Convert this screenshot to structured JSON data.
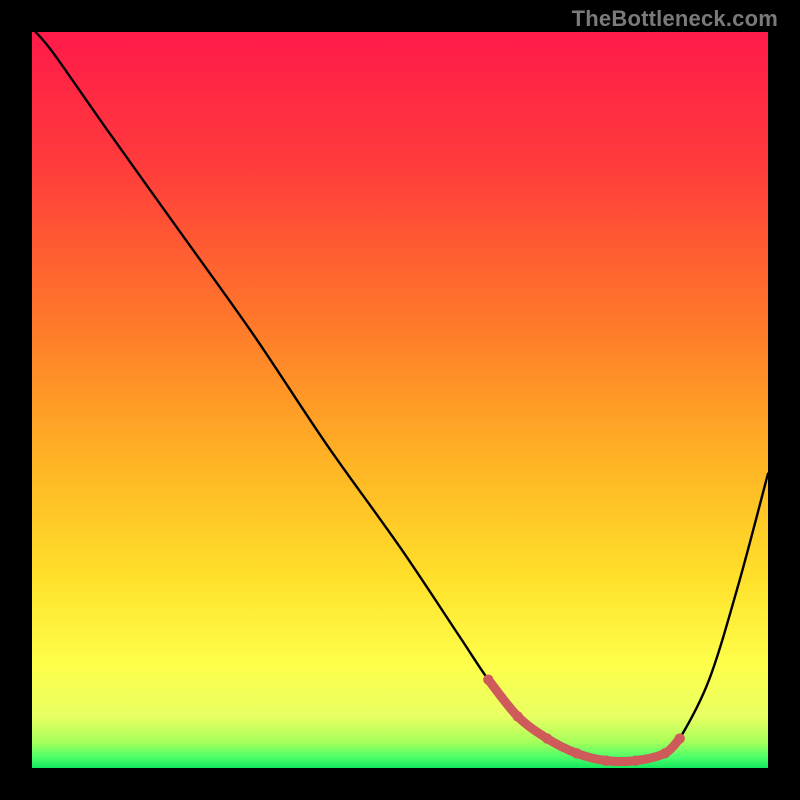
{
  "watermark": "TheBottleneck.com",
  "chart_data": {
    "type": "line",
    "title": "",
    "xlabel": "",
    "ylabel": "",
    "xlim": [
      0,
      100
    ],
    "ylim": [
      0,
      100
    ],
    "grid": false,
    "legend": false,
    "series": [
      {
        "name": "bottleneck-curve",
        "color": "#000000",
        "x": [
          0.5,
          3,
          10,
          20,
          30,
          40,
          50,
          58,
          62,
          66,
          70,
          74,
          78,
          82,
          86,
          88,
          92,
          96,
          100
        ],
        "y": [
          100,
          97,
          87,
          73,
          59,
          44,
          30,
          18,
          12,
          7,
          4,
          2,
          1,
          1,
          2,
          4,
          12,
          25,
          40
        ]
      },
      {
        "name": "bottleneck-threshold-marker",
        "color": "#cf5a5a",
        "x": [
          62,
          66,
          70,
          74,
          78,
          82,
          86,
          88
        ],
        "y": [
          12,
          7,
          4,
          2,
          1,
          1,
          2,
          4
        ]
      }
    ],
    "background_gradient": {
      "stops": [
        {
          "offset": 0.0,
          "color": "#ff1a4a"
        },
        {
          "offset": 0.18,
          "color": "#ff3b3b"
        },
        {
          "offset": 0.4,
          "color": "#ff7a2a"
        },
        {
          "offset": 0.58,
          "color": "#ffb224"
        },
        {
          "offset": 0.74,
          "color": "#ffe02a"
        },
        {
          "offset": 0.86,
          "color": "#feff4a"
        },
        {
          "offset": 0.93,
          "color": "#e8ff63"
        },
        {
          "offset": 0.965,
          "color": "#a6ff5a"
        },
        {
          "offset": 0.985,
          "color": "#4dff6a"
        },
        {
          "offset": 1.0,
          "color": "#15e85f"
        }
      ]
    }
  }
}
